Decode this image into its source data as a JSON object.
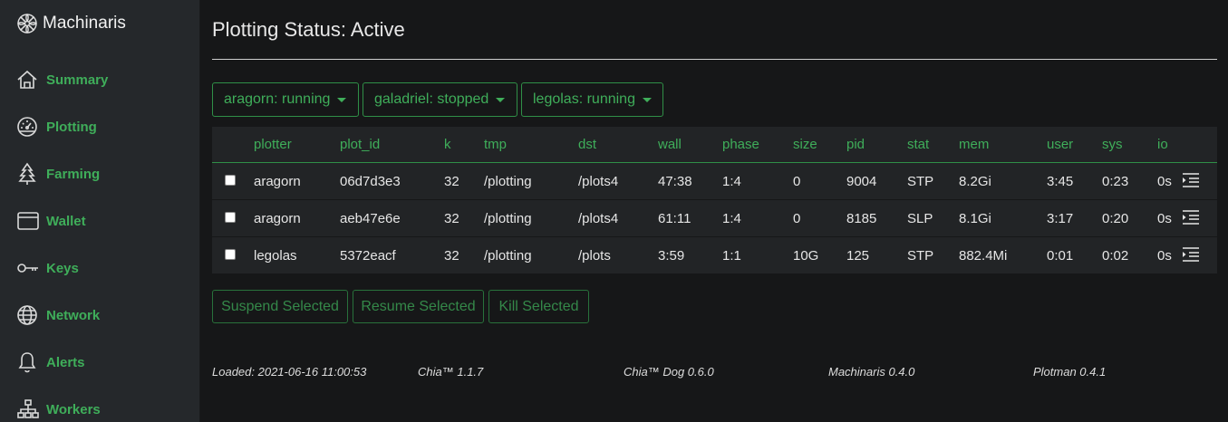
{
  "app": {
    "name": "Machinaris",
    "logo_icon": "machinaris-logo-icon"
  },
  "sidebar": {
    "items": [
      {
        "label": "Summary",
        "icon": "house-icon"
      },
      {
        "label": "Plotting",
        "icon": "speedometer-icon"
      },
      {
        "label": "Farming",
        "icon": "tree-icon"
      },
      {
        "label": "Wallet",
        "icon": "wallet-icon"
      },
      {
        "label": "Keys",
        "icon": "key-icon"
      },
      {
        "label": "Network",
        "icon": "globe-icon"
      },
      {
        "label": "Alerts",
        "icon": "bell-icon"
      },
      {
        "label": "Workers",
        "icon": "diagram-icon"
      }
    ]
  },
  "main": {
    "title": "Plotting Status: Active",
    "workers": [
      {
        "label": "aragorn: running"
      },
      {
        "label": "galadriel: stopped"
      },
      {
        "label": "legolas: running"
      }
    ],
    "table": {
      "columns": [
        "plotter",
        "plot_id",
        "k",
        "tmp",
        "dst",
        "wall",
        "phase",
        "size",
        "pid",
        "stat",
        "mem",
        "user",
        "sys",
        "io"
      ],
      "rows": [
        {
          "plotter": "aragorn",
          "plot_id": "06d7d3e3",
          "k": "32",
          "tmp": "/plotting",
          "dst": "/plots4",
          "wall": "47:38",
          "phase": "1:4",
          "size": "0",
          "pid": "9004",
          "stat": "STP",
          "mem": "8.2Gi",
          "user": "3:45",
          "sys": "0:23",
          "io": "0s"
        },
        {
          "plotter": "aragorn",
          "plot_id": "aeb47e6e",
          "k": "32",
          "tmp": "/plotting",
          "dst": "/plots4",
          "wall": "61:11",
          "phase": "1:4",
          "size": "0",
          "pid": "8185",
          "stat": "SLP",
          "mem": "8.1Gi",
          "user": "3:17",
          "sys": "0:20",
          "io": "0s"
        },
        {
          "plotter": "legolas",
          "plot_id": "5372eacf",
          "k": "32",
          "tmp": "/plotting",
          "dst": "/plots",
          "wall": "3:59",
          "phase": "1:1",
          "size": "10G",
          "pid": "125",
          "stat": "STP",
          "mem": "882.4Mi",
          "user": "0:01",
          "sys": "0:02",
          "io": "0s"
        }
      ]
    },
    "actions": {
      "suspend": "Suspend Selected",
      "resume": "Resume Selected",
      "kill": "Kill Selected"
    }
  },
  "footer": {
    "loaded": "Loaded: 2021-06-16 11:00:53",
    "chia": "Chia™ 1.1.7",
    "chiadog": "Chia™ Dog 0.6.0",
    "machinaris": "Machinaris 0.4.0",
    "plotman": "Plotman 0.4.1"
  },
  "colors": {
    "accent": "#3fae5a",
    "background": "#161718",
    "sidebar": "#25282b",
    "table": "#222426"
  }
}
